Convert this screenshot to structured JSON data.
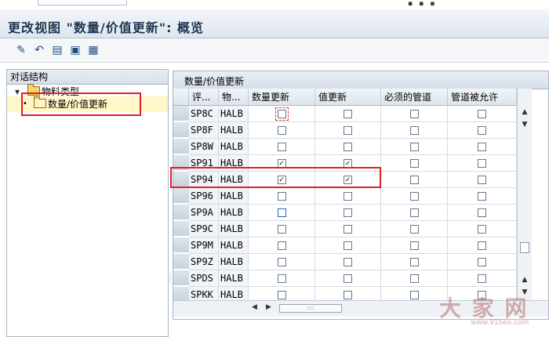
{
  "window": {
    "title": "更改视图 \"数量/价值更新\": 概览"
  },
  "toolbar": {
    "buttons": [
      {
        "name": "edit-pencil-icon",
        "glyph": "✎"
      },
      {
        "name": "undo-icon",
        "glyph": "↶"
      },
      {
        "name": "detail-icon",
        "glyph": "▤"
      },
      {
        "name": "export-icon",
        "glyph": "▣"
      },
      {
        "name": "import-icon",
        "glyph": "▦"
      }
    ]
  },
  "dialog_structure": {
    "header": "对话结构",
    "items": [
      {
        "label": "物料类型",
        "level": 0,
        "expanded": true
      },
      {
        "label": "数量/价值更新",
        "level": 1,
        "selected": true
      }
    ]
  },
  "table": {
    "title": "数量/价值更新",
    "columns": [
      "评...",
      "物...",
      "数量更新",
      "值更新",
      "必须的管道",
      "管道被允许"
    ],
    "rows": [
      {
        "area": "SP8C",
        "type": "HALB",
        "qty": false,
        "val": false,
        "pipe_req": false,
        "pipe_allow": false,
        "focus": true
      },
      {
        "area": "SP8F",
        "type": "HALB",
        "qty": false,
        "val": false,
        "pipe_req": false,
        "pipe_allow": false
      },
      {
        "area": "SP8W",
        "type": "HALB",
        "qty": false,
        "val": false,
        "pipe_req": false,
        "pipe_allow": false
      },
      {
        "area": "SP91",
        "type": "HALB",
        "qty": true,
        "val": true,
        "pipe_req": false,
        "pipe_allow": false
      },
      {
        "area": "SP94",
        "type": "HALB",
        "qty": true,
        "val": true,
        "pipe_req": false,
        "pipe_allow": false
      },
      {
        "area": "SP96",
        "type": "HALB",
        "qty": false,
        "val": false,
        "pipe_req": false,
        "pipe_allow": false
      },
      {
        "area": "SP9A",
        "type": "HALB",
        "qty": false,
        "val": false,
        "pipe_req": false,
        "pipe_allow": false,
        "blue": true
      },
      {
        "area": "SP9C",
        "type": "HALB",
        "qty": false,
        "val": false,
        "pipe_req": false,
        "pipe_allow": false
      },
      {
        "area": "SP9M",
        "type": "HALB",
        "qty": false,
        "val": false,
        "pipe_req": false,
        "pipe_allow": false
      },
      {
        "area": "SP9Z",
        "type": "HALB",
        "qty": false,
        "val": false,
        "pipe_req": false,
        "pipe_allow": false
      },
      {
        "area": "SPDS",
        "type": "HALB",
        "qty": false,
        "val": false,
        "pipe_req": false,
        "pipe_allow": false
      },
      {
        "area": "SPKK",
        "type": "HALB",
        "qty": false,
        "val": false,
        "pipe_req": false,
        "pipe_allow": false
      }
    ]
  },
  "watermark": {
    "text": "大 家 网",
    "url": "www.91bee.com"
  },
  "colors": {
    "highlight": "#e02020",
    "title": "#1e3550",
    "selected_bg": "#fff7c7"
  }
}
